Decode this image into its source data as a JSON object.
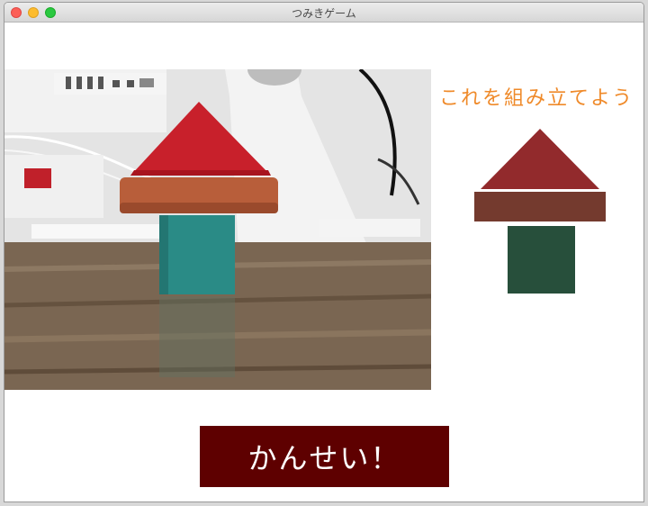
{
  "window": {
    "title": "つみきゲーム"
  },
  "instruction": {
    "text": "これを組み立てよう"
  },
  "done_button": {
    "label": "かんせい！"
  },
  "colors": {
    "heading": "#ef8a2a",
    "button_bg": "#5e0000",
    "target_roof": "#922a2c",
    "target_beam": "#743a2e",
    "target_base": "#274f3b"
  }
}
